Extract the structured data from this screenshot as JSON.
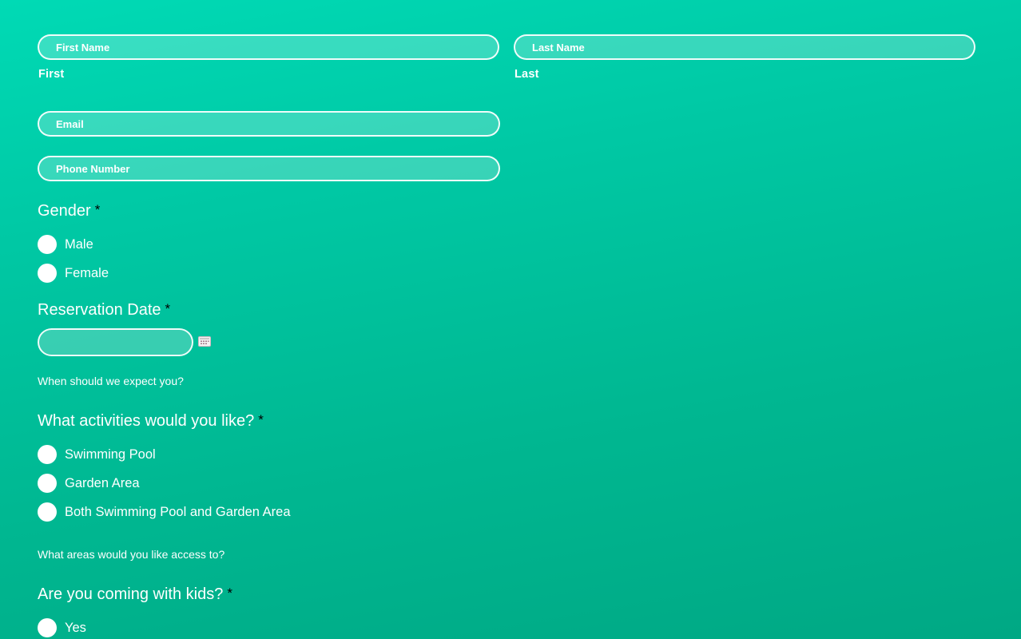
{
  "name_fields": {
    "first": {
      "placeholder": "First Name",
      "sublabel": "First"
    },
    "last": {
      "placeholder": "Last Name",
      "sublabel": "Last"
    }
  },
  "contact_fields": {
    "email": {
      "placeholder": "Email"
    },
    "phone": {
      "placeholder": "Phone Number"
    }
  },
  "gender": {
    "label": "Gender",
    "required": "*",
    "options": [
      "Male",
      "Female"
    ]
  },
  "reservation": {
    "label": "Reservation Date",
    "required": "*",
    "date_value": "",
    "calendar_icon": "calendar-icon",
    "help": "When should we expect you?"
  },
  "activities": {
    "label": "What activities would you like?",
    "required": "*",
    "options": [
      "Swimming Pool",
      "Garden Area",
      "Both Swimming Pool and Garden Area"
    ],
    "help": "What areas would you like access to?"
  },
  "kids": {
    "label": "Are you coming with kids?",
    "required": "*",
    "options": [
      "Yes"
    ]
  },
  "colors": {
    "background_top": "#00dab5",
    "background_bottom": "#00a884",
    "text": "#ffffff",
    "required_marker": "#000000"
  }
}
